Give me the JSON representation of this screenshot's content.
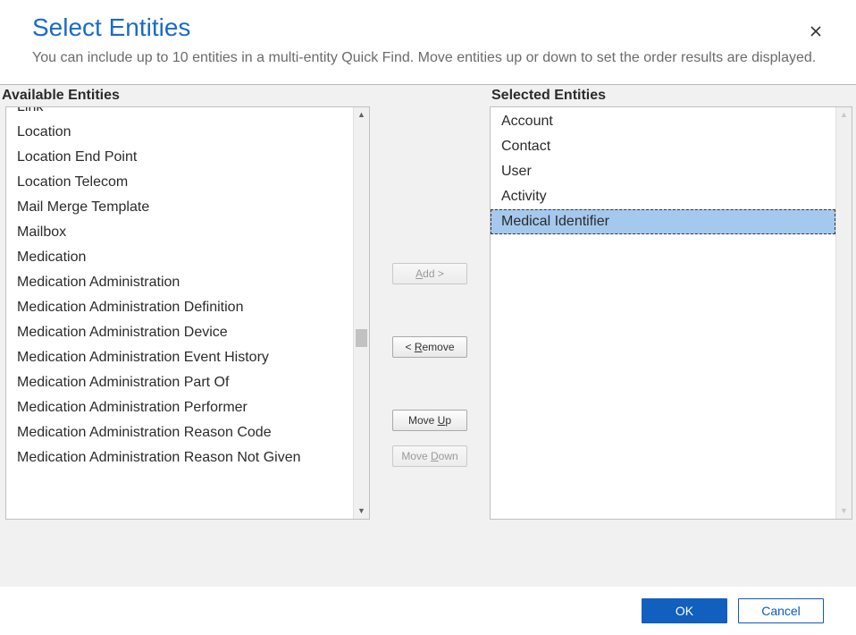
{
  "header": {
    "title": "Select Entities",
    "subtitle": "You can include up to 10 entities in a multi-entity Quick Find. Move entities up or down to set the order results are displayed."
  },
  "labels": {
    "available": "Available Entities",
    "selected": "Selected Entities"
  },
  "available": {
    "items": [
      "Link",
      "Location",
      "Location End Point",
      "Location Telecom",
      "Mail Merge Template",
      "Mailbox",
      "Medication",
      "Medication Administration",
      "Medication Administration Definition",
      "Medication Administration Device",
      "Medication Administration Event History",
      "Medication Administration Part Of",
      "Medication Administration Performer",
      "Medication Administration Reason Code",
      "Medication Administration Reason Not Given"
    ]
  },
  "selected": {
    "items": [
      "Account",
      "Contact",
      "User",
      "Activity",
      "Medical Identifier"
    ],
    "highlighted_index": 4
  },
  "buttons": {
    "add": "Add >",
    "remove": "< Remove",
    "move_up": "Move Up",
    "move_down": "Move Down",
    "ok": "OK",
    "cancel": "Cancel"
  },
  "state": {
    "add_disabled": true,
    "remove_disabled": false,
    "move_up_disabled": false,
    "move_down_disabled": true
  }
}
